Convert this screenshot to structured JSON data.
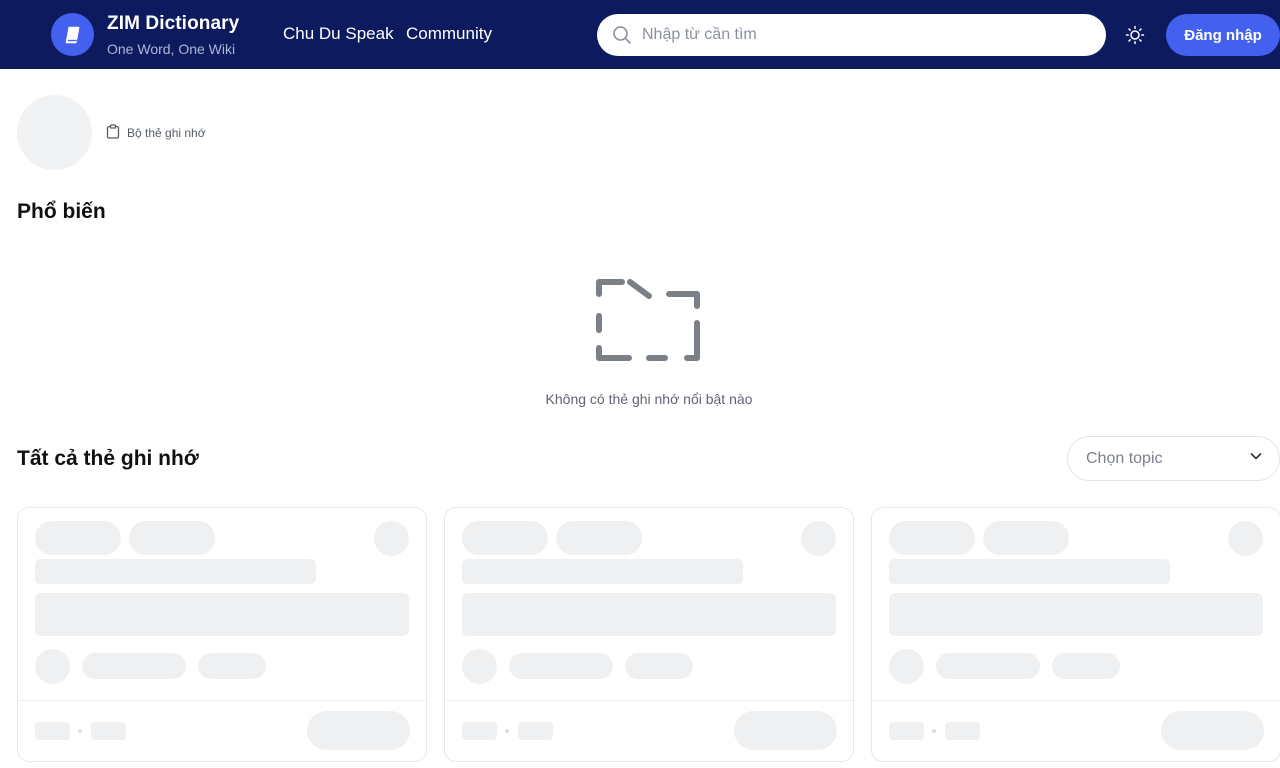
{
  "header": {
    "brand_title": "ZIM Dictionary",
    "brand_subtitle": "One Word, One Wiki",
    "nav": [
      {
        "label": "Chu Du Speak"
      },
      {
        "label": "Community"
      }
    ],
    "search": {
      "placeholder": "Nhập từ cần tìm",
      "value": ""
    },
    "theme_icon": "sun-icon",
    "login_label": "Đăng nhập"
  },
  "profile": {
    "deck_label": "Bộ thẻ ghi nhớ",
    "deck_icon": "clipboard-icon"
  },
  "popular": {
    "title": "Phổ biến",
    "empty_icon": "empty-folder-icon",
    "empty_text": "Không có thẻ ghi nhớ nổi bật nào"
  },
  "all_cards": {
    "title": "Tất cả thẻ ghi nhớ",
    "topic_select": {
      "placeholder": "Chọn topic",
      "icon": "chevron-down-icon"
    }
  },
  "colors": {
    "header_bg": "#0d1b5e",
    "accent": "#4361ee",
    "skeleton": "#eff0f2"
  }
}
